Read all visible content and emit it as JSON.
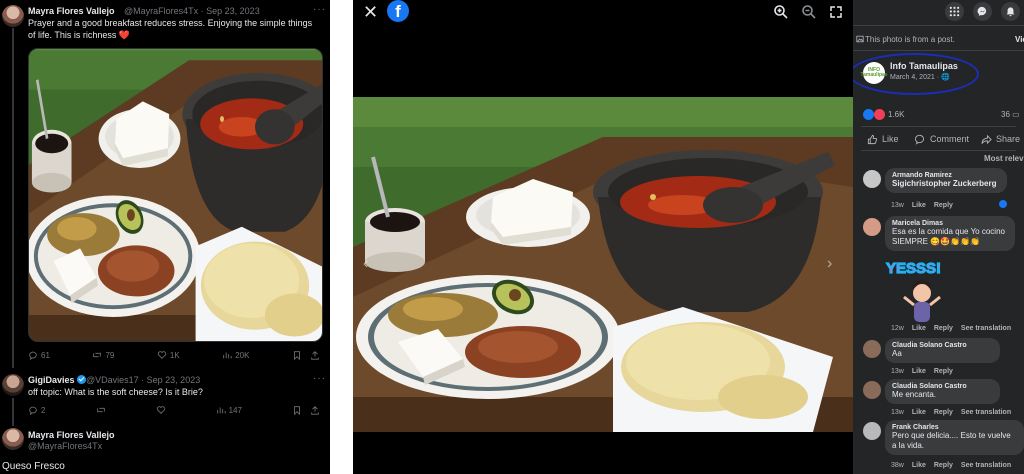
{
  "twitter": {
    "tweets": [
      {
        "name": "Mayra Flores Vallejo",
        "handle_time": "@MayraFlores4Tx · Sep 23, 2023",
        "text": "Prayer and a good breakfast reduces stress. Enjoying the simple things of life. This is richness ❤️",
        "stats": {
          "replies": "61",
          "retweets": "79",
          "likes": "1K",
          "views": "20K"
        }
      },
      {
        "name": "GigiDavies",
        "handle_time": "@VDavies17 · Sep 23, 2023",
        "text": "off topic: What is the soft cheese? Is it Brie?",
        "stats": {
          "replies": "2",
          "retweets": "",
          "likes": "",
          "views": "147"
        }
      },
      {
        "name": "Mayra Flores Vallejo",
        "handle_time": "@MayraFlores4Tx",
        "text": "Queso Fresco"
      }
    ],
    "more_icon": "more-dots-icon"
  },
  "facebook": {
    "viewer": {
      "close_icon": "close-icon",
      "logo": "f",
      "tools": [
        "zoom-in-icon",
        "zoom-out-icon",
        "fullscreen-icon"
      ]
    },
    "panel": {
      "note": "This photo is from a post.",
      "view_label": "Vie",
      "page_name": "Info Tamaulipas",
      "page_logo_text": "INFO Tamaulipas",
      "date": "March 4, 2021 · 🌐",
      "reactions": "1.6K",
      "comments_count": "36",
      "actions": {
        "like": "Like",
        "comment": "Comment",
        "share": "Share"
      },
      "sort_label": "Most relev",
      "comments": [
        {
          "name": "Armando Ramirez",
          "text": "Sigichristopher Zuckerberg",
          "time": "13w",
          "like": "Like",
          "reply": "Reply",
          "translate": ""
        },
        {
          "name": "Maricela Dimas",
          "text": "Esa es la comida que Yo cocino SIEMPRE 😋🤩👏👏👏",
          "time": "12w",
          "like": "Like",
          "reply": "Reply",
          "translate": "See translation",
          "sticker": "YESSS!"
        },
        {
          "name": "Claudia Solano Castro",
          "text": "Aa",
          "time": "13w",
          "like": "Like",
          "reply": "Reply",
          "translate": ""
        },
        {
          "name": "Claudia Solano Castro",
          "text": "Me encanta.",
          "time": "13w",
          "like": "Like",
          "reply": "Reply",
          "translate": "See translation"
        },
        {
          "name": "Frank Charles",
          "text": "Pero que delicia.... Esto te vuelve a la vida.",
          "time": "38w",
          "like": "Like",
          "reply": "Reply",
          "translate": "See translation"
        }
      ]
    }
  },
  "colors": {
    "facebook_blue": "#1877f2",
    "twitter_bg": "#000000",
    "panel_bg": "#242526",
    "annotation_circle": "#1a2eb8"
  }
}
